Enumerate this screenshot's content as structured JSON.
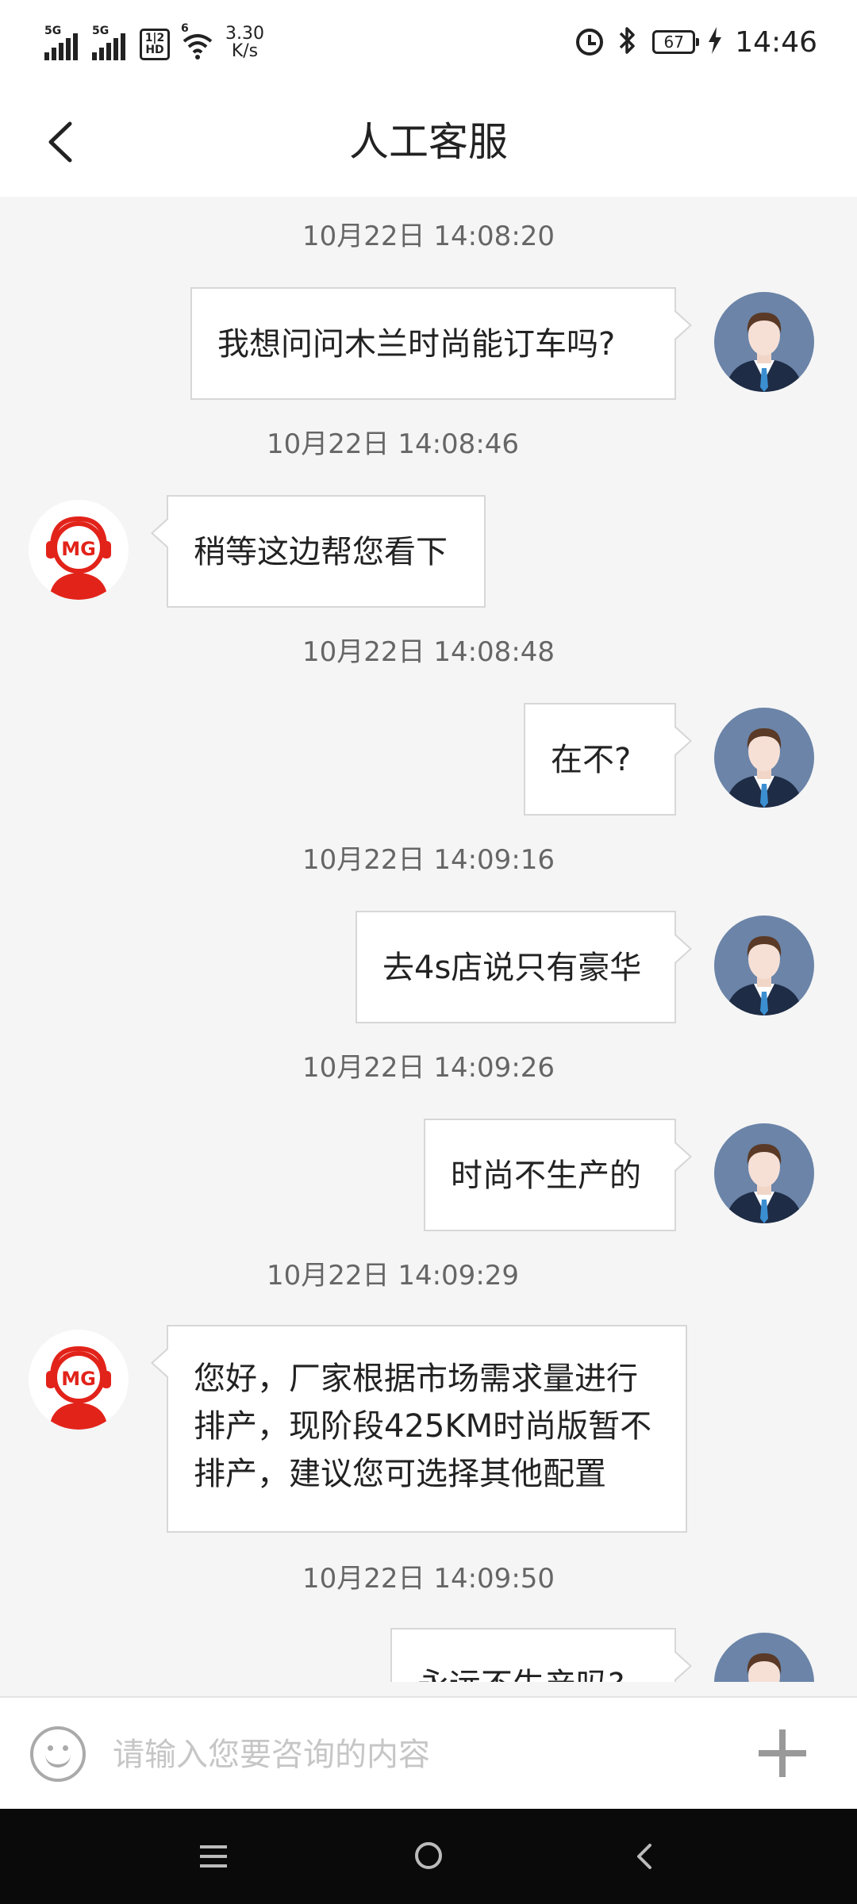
{
  "status_bar": {
    "sim1": "5G",
    "sim2": "5G",
    "hd_top": "1|2",
    "hd_bottom": "HD",
    "wifi_gen": "6",
    "speed_value": "3.30",
    "speed_unit": "K/s",
    "battery": "67",
    "time": "14:46"
  },
  "header": {
    "title": "人工客服"
  },
  "messages": [
    {
      "timestamp": "10月22日 14:08:20",
      "sender": "user",
      "text": "我想问问木兰时尚能订车吗?"
    },
    {
      "timestamp": "10月22日 14:08:46",
      "sender": "agent",
      "text": "稍等这边帮您看下"
    },
    {
      "timestamp": "10月22日 14:08:48",
      "sender": "user",
      "text": "在不?"
    },
    {
      "timestamp": "10月22日 14:09:16",
      "sender": "user",
      "text": "去4s店说只有豪华"
    },
    {
      "timestamp": "10月22日 14:09:26",
      "sender": "user",
      "text": "时尚不生产的"
    },
    {
      "timestamp": "10月22日 14:09:29",
      "sender": "agent",
      "text": "您好，厂家根据市场需求量进行排产，现阶段425KM时尚版暂不排产，建议您可选择其他配置"
    },
    {
      "timestamp": "10月22日 14:09:50",
      "sender": "user",
      "text": "永远不生产吗?"
    }
  ],
  "agent_logo_text": "MG",
  "input": {
    "placeholder": "请输入您要咨询的内容",
    "value": ""
  },
  "colors": {
    "brand_red": "#e2231a",
    "avatar_bg": "#6b84a8",
    "bubble_border": "#d7d7d7",
    "chat_bg": "#f5f5f5"
  },
  "icons": {
    "back": "chevron-left-icon",
    "emoji": "smiley-icon",
    "add": "plus-icon",
    "nav_menu": "menu-icon",
    "nav_home": "home-circle-icon",
    "nav_back": "back-triangle-icon"
  }
}
